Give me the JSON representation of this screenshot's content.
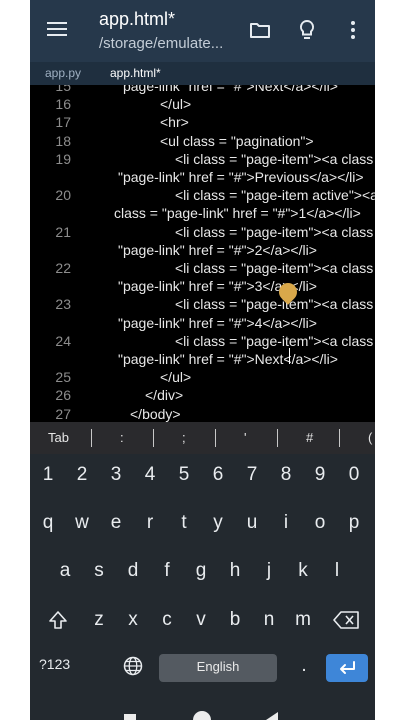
{
  "toolbar": {
    "title": "app.html*",
    "path": "/storage/emulate..."
  },
  "tabs": [
    {
      "label": "app.py"
    },
    {
      "label": "app.html*"
    }
  ],
  "editor": {
    "lines": [
      {
        "num": "15",
        "text": "\"page-link\" href = \"#\">Next</a></li>"
      },
      {
        "num": "16",
        "text": "</ul>"
      },
      {
        "num": "17",
        "text": "<hr>"
      },
      {
        "num": "18",
        "text": "<ul class = \"pagination\">"
      },
      {
        "num": "19",
        "text": "<li class = \"page-item\"><a class ="
      },
      {
        "num": "",
        "text": "\"page-link\" href = \"#\">Previous</a></li>"
      },
      {
        "num": "20",
        "text": "<li class = \"page-item active\"><a"
      },
      {
        "num": "",
        "text": "class = \"page-link\" href = \"#\">1</a></li>"
      },
      {
        "num": "21",
        "text": "<li class = \"page-item\"><a class ="
      },
      {
        "num": "",
        "text": "\"page-link\" href = \"#\">2</a></li>"
      },
      {
        "num": "22",
        "text": "<li class = \"page-item\"><a class ="
      },
      {
        "num": "",
        "text": "\"page-link\" href = \"#\">3</a></li>"
      },
      {
        "num": "23",
        "text": "<li class = \"page-item\"><a class ="
      },
      {
        "num": "",
        "text": "\"page-link\" href = \"#\">4</a></li>"
      },
      {
        "num": "24",
        "text": "<li class = \"page-item\"><a class ="
      },
      {
        "num": "",
        "text": "\"page-link\" href = \"#\">Next</a></li>"
      },
      {
        "num": "25",
        "text": "</ul>"
      },
      {
        "num": "26",
        "text": "</div>"
      },
      {
        "num": "27",
        "text": "</body>"
      }
    ]
  },
  "symbols": [
    "Tab",
    ":",
    ";",
    "'",
    "#",
    "("
  ],
  "keyboard": {
    "numbers": [
      "1",
      "2",
      "3",
      "4",
      "5",
      "6",
      "7",
      "8",
      "9",
      "0"
    ],
    "row1": [
      "q",
      "w",
      "e",
      "r",
      "t",
      "y",
      "u",
      "i",
      "o",
      "p"
    ],
    "row2": [
      "a",
      "s",
      "d",
      "f",
      "g",
      "h",
      "j",
      "k",
      "l"
    ],
    "row3": [
      "z",
      "x",
      "c",
      "v",
      "b",
      "n",
      "m"
    ],
    "symbols_key": "?123",
    "space_label": "English",
    "period": "."
  },
  "icons": {
    "menu": "hamburger-menu-icon",
    "folder": "folder-icon",
    "bulb": "lightbulb-icon",
    "more": "more-vertical-icon",
    "run": "play-icon",
    "shift": "shift-icon",
    "backspace": "backspace-icon",
    "globe": "globe-icon",
    "enter": "enter-icon"
  },
  "colors": {
    "toolbar": "#26384b",
    "tabs": "#1f2f3f",
    "editor_bg": "#000000",
    "keyboard_bg": "#23292f",
    "enter_key": "#3e86d8",
    "fab": "#b48c32"
  }
}
